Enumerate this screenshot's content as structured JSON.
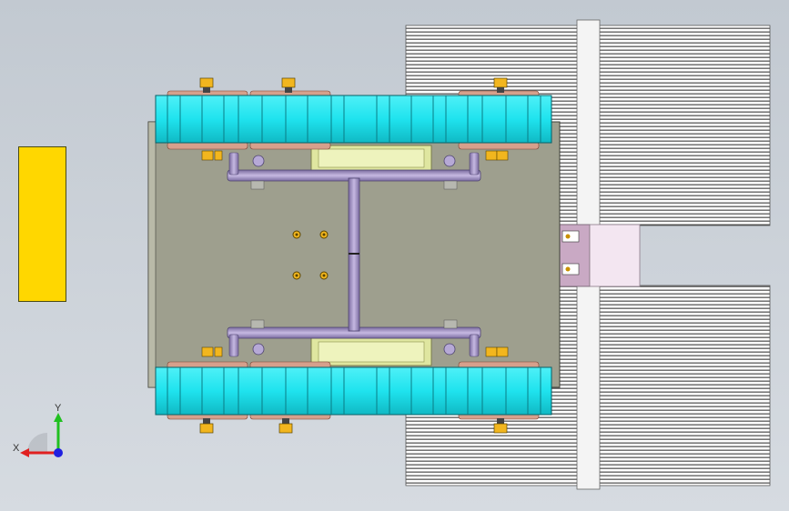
{
  "viewport": {
    "background_top": "#c2c9d1",
    "background_bottom": "#d6dbe1"
  },
  "colors": {
    "track_cyan": "#1fe3ee",
    "chassis_plate": "#9e9f8e",
    "heatsink_fin": "#ffffff",
    "heatsink_gap": "#3a3a3a",
    "axle_purple": "#a596c4",
    "bolt_gold": "#f2b61e",
    "wheel_rim": "#d6a08c",
    "battery_yellow": "#e8eeaa",
    "side_panel_yellow": "#ffd700",
    "connector_block": "#f3e6f1",
    "axis_x": "#e02020",
    "axis_y": "#20c020",
    "axis_z": "#2020e0"
  },
  "triad": {
    "x_label": "X",
    "y_label": "Y"
  },
  "icons": {
    "triad": "coordinate-triad-icon"
  }
}
